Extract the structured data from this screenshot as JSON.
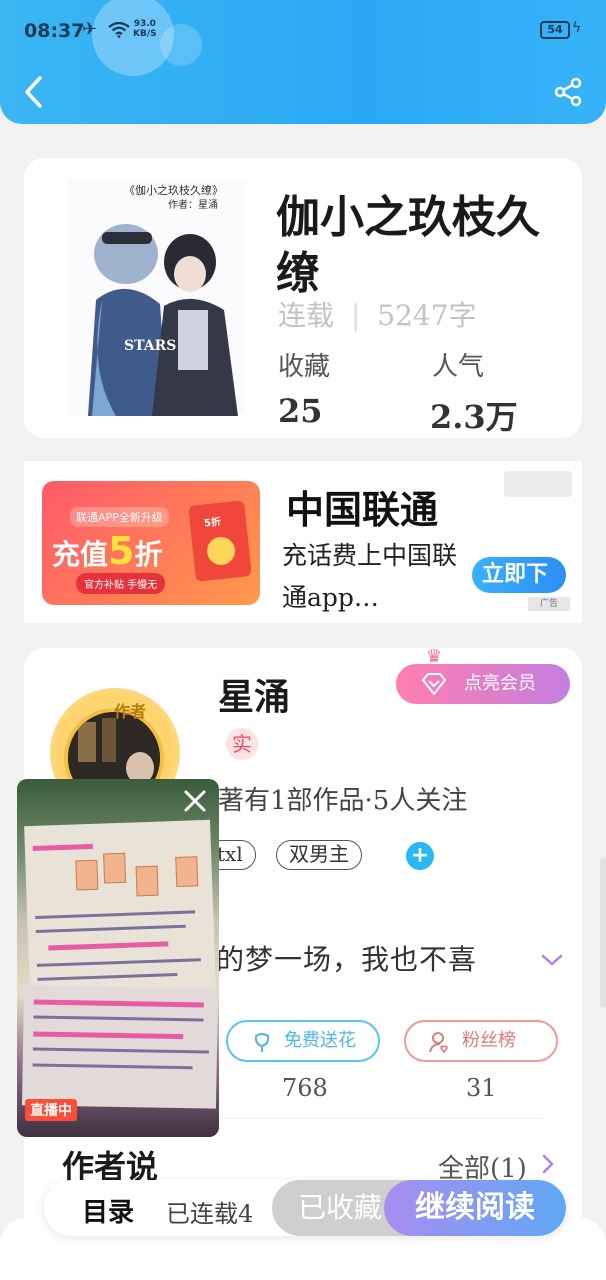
{
  "status_bar": {
    "time": "08:37",
    "net_speed_value": "93.0",
    "net_speed_unit": "KB/S",
    "battery": "54"
  },
  "book": {
    "title": "伽小之玖枝久缭",
    "status": "连载",
    "words": "5247字",
    "favorites_label": "收藏",
    "favorites_value": "25",
    "popularity_label": "人气",
    "popularity_value": "2.3万",
    "cover_title": "《伽小之玖枝久缭》",
    "cover_author": "作者：星涌",
    "cover_word": "STARS"
  },
  "ad": {
    "image_subtitle": "联通APP全新升级",
    "image_headline": "充值",
    "image_number": "5",
    "image_suffix": "折",
    "image_footer": "官方补贴 手慢无",
    "envelope_label": "5折",
    "title": "中国联通",
    "description": "充话费上中国联通app…",
    "button": "立即下",
    "mark": "广告"
  },
  "author": {
    "avatar_tag": "作者",
    "name": "星涌",
    "verified": "实",
    "vip_button": "点亮会员",
    "works": "著有1部作品·5人关注",
    "tags": [
      "txl",
      "双男主"
    ],
    "intro": "的梦一场，我也不喜",
    "flower_button": "免费送花",
    "fans_button": "粉丝榜",
    "flower_count": "768",
    "fans_count": "31",
    "author_says": "作者说",
    "all_link": "全部(1)"
  },
  "bottom": {
    "catalog": "目录",
    "serial": "已连载4",
    "favorited": "已收藏",
    "continue": "继续阅读"
  },
  "floating_video": {
    "live_label": "直播中"
  },
  "colors": {
    "header": "#2aa8f5",
    "accent_blue": "#27b8f4",
    "vip_gradient_start": "#ff7eb0",
    "vip_gradient_end": "#c57ee0",
    "read_gradient_start": "#a88ef0",
    "read_gradient_end": "#5fa8f5"
  }
}
